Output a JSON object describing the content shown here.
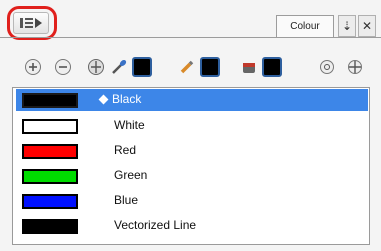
{
  "header": {
    "tab_label": "Colour"
  },
  "palette": {
    "rows": [
      {
        "name": "Black",
        "color": "#000000",
        "selected": true
      },
      {
        "name": "White",
        "color": "#ffffff",
        "selected": false
      },
      {
        "name": "Red",
        "color": "#ff0000",
        "selected": false
      },
      {
        "name": "Green",
        "color": "#00dd00",
        "selected": false
      },
      {
        "name": "Blue",
        "color": "#0010ff",
        "selected": false
      },
      {
        "name": "Vectorized Line",
        "color": "#000000",
        "selected": false
      }
    ]
  },
  "colors": {
    "selection": "#3d86e8",
    "highlight_ring": "#e0201c"
  }
}
